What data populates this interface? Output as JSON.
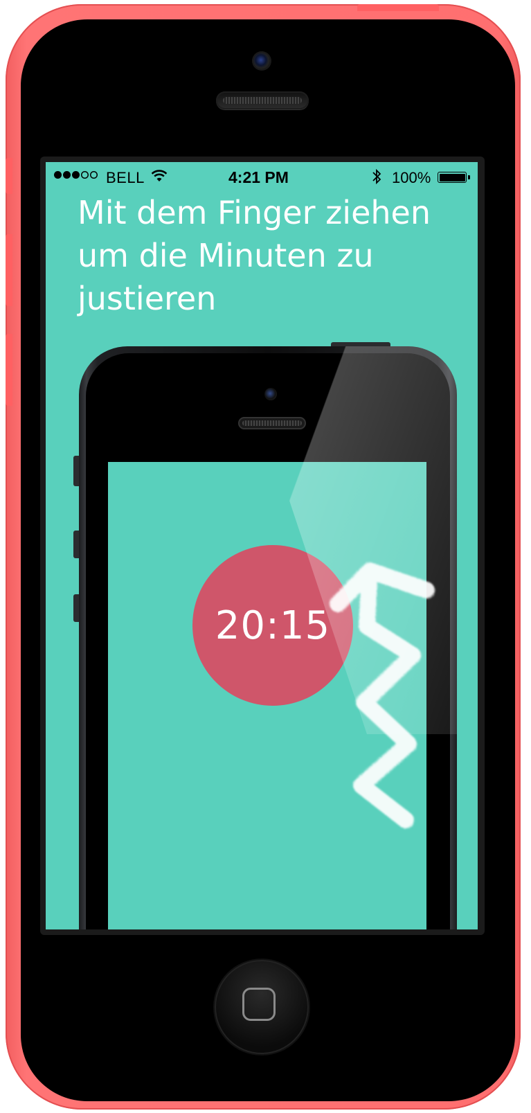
{
  "status_bar": {
    "carrier": "BELL",
    "time": "4:21 PM",
    "battery_percent": "100%",
    "signal_bars_filled": 3,
    "signal_bars_total": 5,
    "icons": [
      "signal-dots-icon",
      "wifi-icon",
      "bluetooth-icon",
      "battery-icon"
    ]
  },
  "instruction": {
    "text": "Mit dem Finger ziehen um die Minuten zu justieren"
  },
  "timer": {
    "value": "20:15"
  },
  "colors": {
    "screen_background": "#59d0bc",
    "timer_circle": "#cf566a",
    "outer_phone_shell": "#ff6f70",
    "text": "#ffffff"
  }
}
